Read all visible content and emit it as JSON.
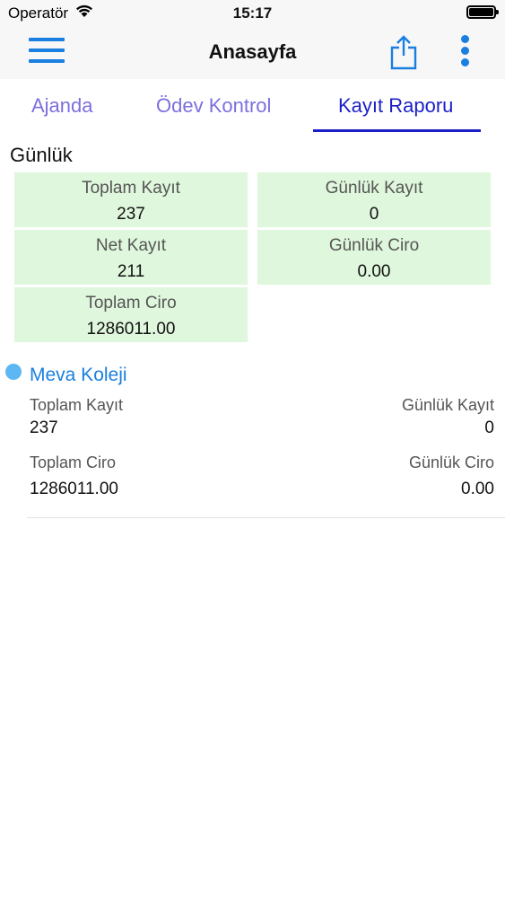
{
  "status_bar": {
    "carrier": "Operatör",
    "time": "15:17"
  },
  "navbar": {
    "title": "Anasayfa",
    "menu_icon": "hamburger-menu-icon",
    "share_icon": "share-icon",
    "more_icon": "more-vertical-icon",
    "accent_color": "#1a7fe0"
  },
  "tabs": [
    {
      "label": "Ajanda",
      "active": false
    },
    {
      "label": "Ödev Kontrol",
      "active": false
    },
    {
      "label": "Kayıt Raporu",
      "active": true
    }
  ],
  "daily": {
    "title": "Günlük",
    "cards": [
      {
        "label": "Toplam Kayıt",
        "value": "237"
      },
      {
        "label": "Günlük Kayıt",
        "value": "0"
      },
      {
        "label": "Net Kayıt",
        "value": "211"
      },
      {
        "label": "Günlük Ciro",
        "value": "0.00"
      },
      {
        "label": "Toplam Ciro",
        "value": "1286011.00"
      }
    ],
    "card_color": "#dff7dc"
  },
  "school": {
    "name": "Meva Koleji",
    "dot_color": "#5cb7f2",
    "toplam_kayit_label": "Toplam Kayıt",
    "toplam_kayit_value": "237",
    "gunluk_kayit_label": "Günlük Kayıt",
    "gunluk_kayit_value": "0",
    "toplam_ciro_label": "Toplam Ciro",
    "toplam_ciro_value": "1286011.00",
    "gunluk_ciro_label": "Günlük Ciro",
    "gunluk_ciro_value": "0.00"
  }
}
